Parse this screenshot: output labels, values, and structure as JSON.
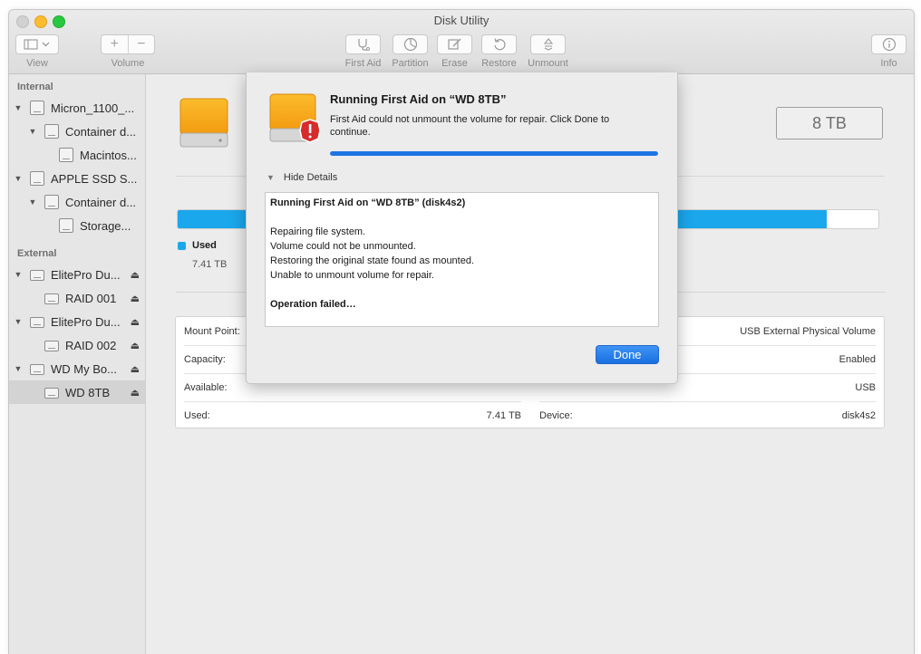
{
  "window": {
    "title": "Disk Utility"
  },
  "toolbar": {
    "view_label": "View",
    "volume_label": "Volume",
    "first_aid_label": "First Aid",
    "partition_label": "Partition",
    "erase_label": "Erase",
    "restore_label": "Restore",
    "unmount_label": "Unmount",
    "info_label": "Info"
  },
  "sidebar": {
    "internal_header": "Internal",
    "external_header": "External",
    "internal_items": [
      {
        "label": "Micron_1100_..."
      },
      {
        "label": "Container d..."
      },
      {
        "label": "Macintos..."
      },
      {
        "label": "APPLE SSD S..."
      },
      {
        "label": "Container d..."
      },
      {
        "label": "Storage..."
      }
    ],
    "external_items": [
      {
        "label": "ElitePro Du..."
      },
      {
        "label": "RAID 001"
      },
      {
        "label": "ElitePro Du..."
      },
      {
        "label": "RAID 002"
      },
      {
        "label": "WD My Bo..."
      },
      {
        "label": "WD 8TB",
        "selected": true
      }
    ]
  },
  "main": {
    "capacity_badge": "8 TB",
    "usage_fraction": 0.926,
    "legend": {
      "name": "Used",
      "value": "7.41 TB"
    },
    "table": {
      "left": [
        {
          "label": "Mount Point:",
          "value": ""
        },
        {
          "label": "Capacity:",
          "value": ""
        },
        {
          "label": "Available:",
          "value": ""
        },
        {
          "label": "Used:",
          "value": "7.41 TB"
        }
      ],
      "right": [
        {
          "label": "",
          "value": "USB External Physical Volume"
        },
        {
          "label": "",
          "value": "Enabled"
        },
        {
          "label": "",
          "value": "USB"
        },
        {
          "label": "Device:",
          "value": "disk4s2"
        }
      ]
    }
  },
  "sheet": {
    "title": "Running First Aid on “WD 8TB”",
    "message": "First Aid could not unmount the volume for repair. Click Done to continue.",
    "progress": 1.0,
    "hide_details_label": "Hide Details",
    "log": {
      "heading": "Running First Aid on “WD 8TB” (disk4s2)",
      "lines": [
        "Repairing file system.",
        "Volume could not be unmounted.",
        "Restoring the original state found as mounted.",
        "Unable to unmount volume for repair."
      ],
      "result": "Operation failed…"
    },
    "done_label": "Done"
  },
  "colors": {
    "accent": "#1c74e6",
    "usage_blue": "#1aa7ec",
    "drive_orange": "#f7a51a",
    "alert_red": "#d62c2c"
  }
}
